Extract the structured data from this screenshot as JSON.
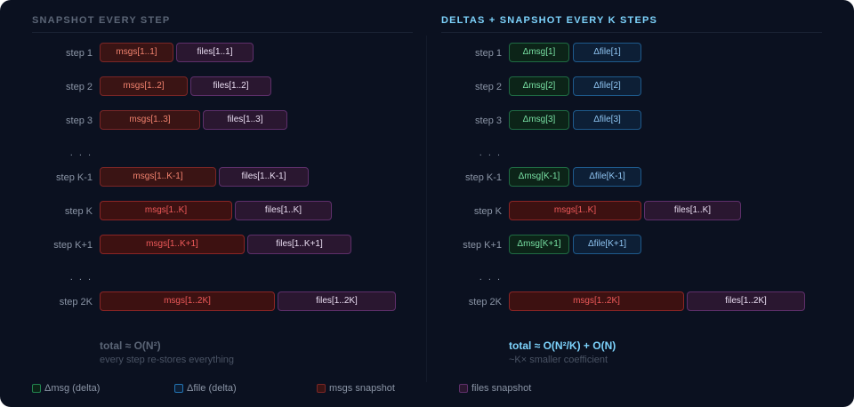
{
  "left": {
    "title": "SNAPSHOT EVERY STEP",
    "steps": [
      {
        "label": "step 1",
        "msgs": "msgs[1..1]",
        "files": "files[1..1]"
      },
      {
        "label": "step 2",
        "msgs": "msgs[1..2]",
        "files": "files[1..2]"
      },
      {
        "label": "step 3",
        "msgs": "msgs[1..3]",
        "files": "files[1..3]"
      },
      {
        "label": "step K-1",
        "msgs": "msgs[1..K-1]",
        "files": "files[1..K-1]"
      },
      {
        "label": "step K",
        "msgs": "msgs[1..K]",
        "files": "files[1..K]"
      },
      {
        "label": "step K+1",
        "msgs": "msgs[1..K+1]",
        "files": "files[1..K+1]"
      },
      {
        "label": "step 2K",
        "msgs": "msgs[1..2K]",
        "files": "files[1..2K]"
      }
    ],
    "ellipsis": ". . .",
    "total": "total ≈ O(N²)",
    "subtitle": "every step re-stores everything"
  },
  "right": {
    "title": "DELTAS + SNAPSHOT EVERY K STEPS",
    "steps": [
      {
        "label": "step 1",
        "dmsg": "Δmsg[1]",
        "dfile": "Δfile[1]"
      },
      {
        "label": "step 2",
        "dmsg": "Δmsg[2]",
        "dfile": "Δfile[2]"
      },
      {
        "label": "step 3",
        "dmsg": "Δmsg[3]",
        "dfile": "Δfile[3]"
      },
      {
        "label": "step K-1",
        "dmsg": "Δmsg[K-1]",
        "dfile": "Δfile[K-1]"
      },
      {
        "label": "step K",
        "msgs": "msgs[1..K]",
        "files": "files[1..K]"
      },
      {
        "label": "step K+1",
        "dmsg": "Δmsg[K+1]",
        "dfile": "Δfile[K+1]"
      },
      {
        "label": "step 2K",
        "msgs": "msgs[1..2K]",
        "files": "files[1..2K]"
      }
    ],
    "ellipsis": ". . .",
    "total": "total ≈ O(N²/K) + O(N)",
    "subtitle": "~K× smaller coefficient"
  },
  "legend": [
    {
      "label": "Δmsg (delta)",
      "color": "#22834f"
    },
    {
      "label": "Δfile (delta)",
      "color": "#2374b3"
    },
    {
      "label": "msgs snapshot",
      "color": "#7a2626"
    },
    {
      "label": "files snapshot",
      "color": "#5e2f6a"
    }
  ]
}
